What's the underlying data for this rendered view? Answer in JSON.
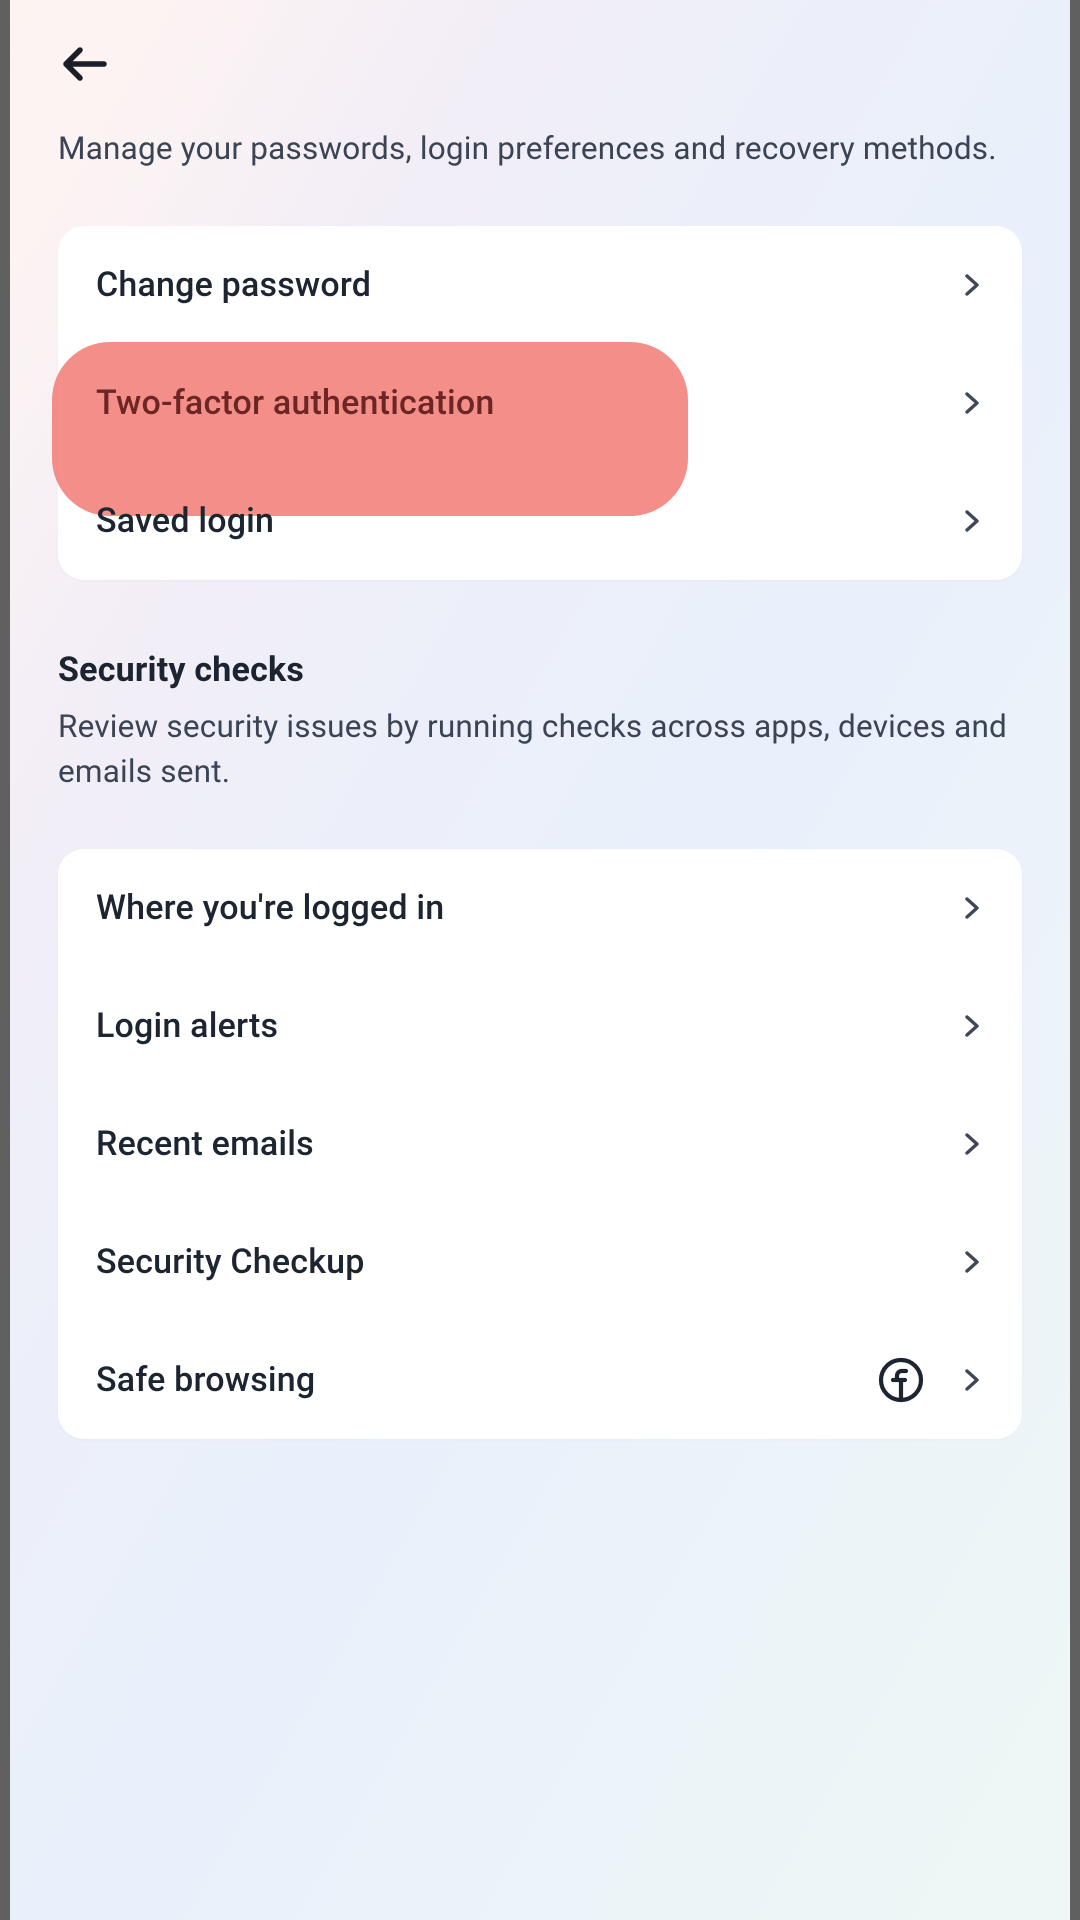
{
  "intro": "Manage your passwords, login preferences and recovery methods.",
  "card1": {
    "items": [
      {
        "label": "Change password"
      },
      {
        "label": "Two-factor authentication",
        "highlighted": true
      },
      {
        "label": "Saved login"
      }
    ]
  },
  "section2": {
    "heading": "Security checks",
    "sub": "Review security issues by running checks across apps, devices and emails sent."
  },
  "card2": {
    "items": [
      {
        "label": "Where you're logged in"
      },
      {
        "label": "Login alerts"
      },
      {
        "label": "Recent emails"
      },
      {
        "label": "Security Checkup"
      },
      {
        "label": "Safe browsing",
        "fb": true
      }
    ]
  }
}
